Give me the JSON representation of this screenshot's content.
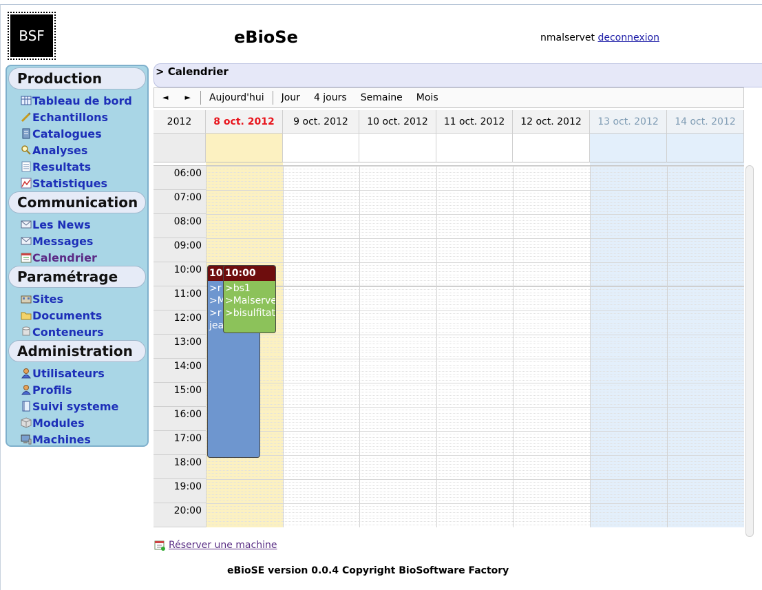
{
  "header": {
    "logo_text": "BSF",
    "app_title": "eBioSe",
    "username": "nmalservet",
    "logout_label": "deconnexion"
  },
  "sidebar": {
    "sections": [
      {
        "title": "Production",
        "items": [
          {
            "label": "Tableau de bord",
            "icon": "dashboard-icon"
          },
          {
            "label": "Echantillons",
            "icon": "pipette-icon"
          },
          {
            "label": "Catalogues",
            "icon": "catalog-icon"
          },
          {
            "label": "Analyses",
            "icon": "magnifier-icon"
          },
          {
            "label": "Resultats",
            "icon": "results-icon"
          },
          {
            "label": "Statistiques",
            "icon": "stats-icon"
          }
        ]
      },
      {
        "title": "Communication",
        "items": [
          {
            "label": "Les News",
            "icon": "envelope-icon"
          },
          {
            "label": "Messages",
            "icon": "envelope-icon"
          },
          {
            "label": "Calendrier",
            "icon": "calendar-icon"
          }
        ]
      },
      {
        "title": "Paramétrage",
        "items": [
          {
            "label": "Sites",
            "icon": "building-icon"
          },
          {
            "label": "Documents",
            "icon": "folder-icon"
          },
          {
            "label": "Conteneurs",
            "icon": "cylinder-icon"
          }
        ]
      },
      {
        "title": "Administration",
        "items": [
          {
            "label": "Utilisateurs",
            "icon": "user-icon"
          },
          {
            "label": "Profils",
            "icon": "user-icon"
          },
          {
            "label": "Suivi systeme",
            "icon": "book-icon"
          },
          {
            "label": "Modules",
            "icon": "cube-icon"
          },
          {
            "label": "Machines",
            "icon": "computer-icon"
          }
        ]
      }
    ]
  },
  "breadcrumb": "> Calendrier",
  "toolbar": {
    "prev": "◄",
    "next": "►",
    "today": "Aujourd'hui",
    "views": [
      "Jour",
      "4 jours",
      "Semaine",
      "Mois"
    ]
  },
  "calendar": {
    "year": "2012",
    "days": [
      "8 oct. 2012",
      "9 oct. 2012",
      "10 oct. 2012",
      "11 oct. 2012",
      "12 oct. 2012",
      "13 oct. 2012",
      "14 oct. 2012"
    ],
    "hours": [
      "06:00",
      "07:00",
      "08:00",
      "09:00",
      "10:00",
      "11:00",
      "12:00",
      "13:00",
      "14:00",
      "15:00",
      "16:00",
      "17:00",
      "18:00",
      "19:00",
      "20:00"
    ],
    "events": [
      {
        "time": "10",
        "lines": [
          ">r",
          ">M",
          ">r",
          "jean-miche"
        ],
        "start": "10:00",
        "end": "18:00",
        "color": "#6e96cf"
      },
      {
        "time": "10:00",
        "lines": [
          ">bs1",
          ">Malserve",
          ">bisulfitat"
        ],
        "start": "10:00",
        "end": "12:50",
        "color": "#8cc25a"
      }
    ],
    "colors": {
      "today": "#fcf1c1",
      "weekend": "#e3effb",
      "today_label": "#e8141c",
      "weekend_label": "#7f9cb4"
    }
  },
  "reserve_link": "Réserver une machine",
  "footer": "eBioSE version 0.0.4 Copyright BioSoftware Factory"
}
